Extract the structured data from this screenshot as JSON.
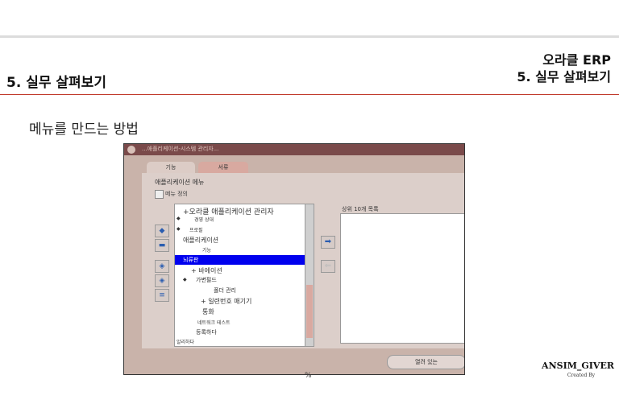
{
  "slide": {
    "title": "5. 실무 살펴보기",
    "brand_line1": "오라클 ERP",
    "brand_line2": "5. 실무 살펴보기",
    "subtitle": "메뉴를 만드는 방법",
    "footer_mark": "%"
  },
  "screenshot": {
    "window_title": "...애플리케이션-시스템 관리자...",
    "tabs": [
      "기능",
      "서류"
    ],
    "app_label": "애플리케이션 메뉴",
    "checkbox_label": "메뉴 정의",
    "tree_items": [
      "+오라클 애플리케이션 관리자",
      "경영 상대",
      "프로필",
      "애플리케이션",
      "기능",
      "+ 바에이션",
      "가변필드",
      "폴더 관리",
      "+ 일련번호 매기기",
      "통화",
      "네트워크 테스트",
      "등록하다",
      "알리하다"
    ],
    "selected_item": "뇌류판",
    "right_label": "상위 10개 목록",
    "bottom_button": "열려 있는"
  },
  "credit": {
    "name": "ANSIM_GIVER",
    "created": "Created By"
  }
}
